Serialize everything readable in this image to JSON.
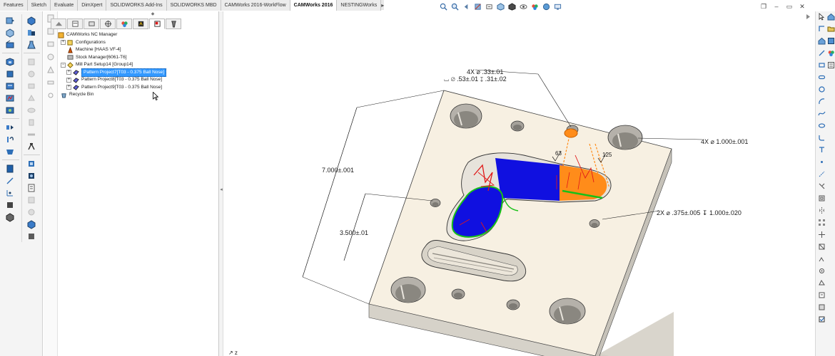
{
  "tabs": {
    "items": [
      "Features",
      "Sketch",
      "Evaluate",
      "DimXpert",
      "SOLIDWORKS Add-Ins",
      "SOLIDWORKS MBD",
      "CAMWorks 2016-WorkFlow",
      "CAMWorks 2016",
      "NESTINGWorks"
    ],
    "active_index": 7
  },
  "panel": {
    "tree": {
      "root": "CAMWorks NC Manager",
      "configurations": "Configurations",
      "machine": "Machine [HAAS VF-4]",
      "stock": "Stock Manager[6061-T6]",
      "setup": "Mill Part Setup14 [Group14]",
      "pattern7": "Pattern Project7[T03 - 0.375 Ball Nose]",
      "pattern8": "Pattern Project8[T03 - 0.375 Ball Nose]",
      "pattern9": "Pattern Project9[T03 - 0.375 Ball Nose]",
      "recycle": "Recycle Bin"
    }
  },
  "drawing": {
    "dim_hole_count": "4X ⌀ .33±.01",
    "dim_cbore": "⌴ ⌀ .53±.01 ↧ .31±.02",
    "dim_large_holes": "4X ⌀ 1.000±.001",
    "dim_length": "7.000±.001",
    "dim_mid": "3.500±.01",
    "dim_pin_holes": "2X ⌀ .375±.005 ↧ 1.000±.020",
    "dim_63": "63",
    "dim_125": "125",
    "triad": "↗ z"
  },
  "colors": {
    "part_face": "#f7f0e2",
    "part_side": "#d9d5cc",
    "toolpath_blue": "#1010e0",
    "toolpath_orange": "#ff8c1a",
    "toolpath_red": "#e01818",
    "toolpath_green": "#18c018",
    "selection": "#3399ff"
  }
}
